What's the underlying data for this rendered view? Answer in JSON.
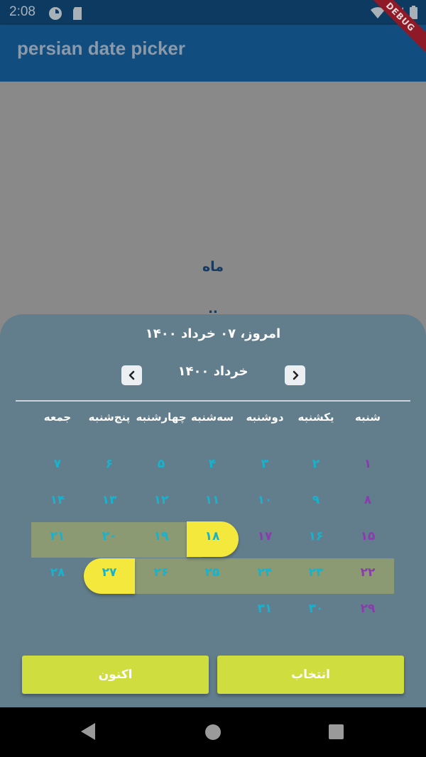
{
  "status_bar": {
    "time": "2:08"
  },
  "app_bar": {
    "title": "persian date picker",
    "debug_label": "DEBUG"
  },
  "background": {
    "label": "ماه",
    "partial": ".."
  },
  "picker": {
    "today_text": "امروز، ۰۷ خرداد ۱۴۰۰",
    "month_title": "خرداد ۱۴۰۰",
    "prev_icon": "chevron-left-icon",
    "next_icon": "chevron-right-icon",
    "weekdays": [
      "شنبه",
      "یکشنبه",
      "دوشنبه",
      "سه‌شنبه",
      "چهارشنبه",
      "پنج‌شنبه",
      "جمعه"
    ],
    "weeks": [
      [
        "۱",
        "۲",
        "۳",
        "۴",
        "۵",
        "۶",
        "۷"
      ],
      [
        "۸",
        "۹",
        "۱۰",
        "۱۱",
        "۱۲",
        "۱۳",
        "۱۴"
      ],
      [
        "۱۵",
        "۱۶",
        "۱۷",
        "۱۸",
        "۱۹",
        "۲۰",
        "۲۱"
      ],
      [
        "۲۲",
        "۲۳",
        "۲۴",
        "۲۵",
        "۲۶",
        "۲۷",
        "۲۸"
      ],
      [
        "۲۹",
        "۳۰",
        "۳۱",
        "",
        "",
        "",
        ""
      ]
    ],
    "range_start": "۱۸",
    "range_end": "۲۷",
    "select_button": "انتخاب",
    "now_button": "اکنون"
  },
  "colors": {
    "sheet": "#627d8c",
    "range": "#8b9a73",
    "selected": "#f3e83b",
    "button": "#cfdd3e",
    "day_text": "#16b3cf",
    "saturday_text": "#8a3cae",
    "app_bar": "#114d7f"
  }
}
